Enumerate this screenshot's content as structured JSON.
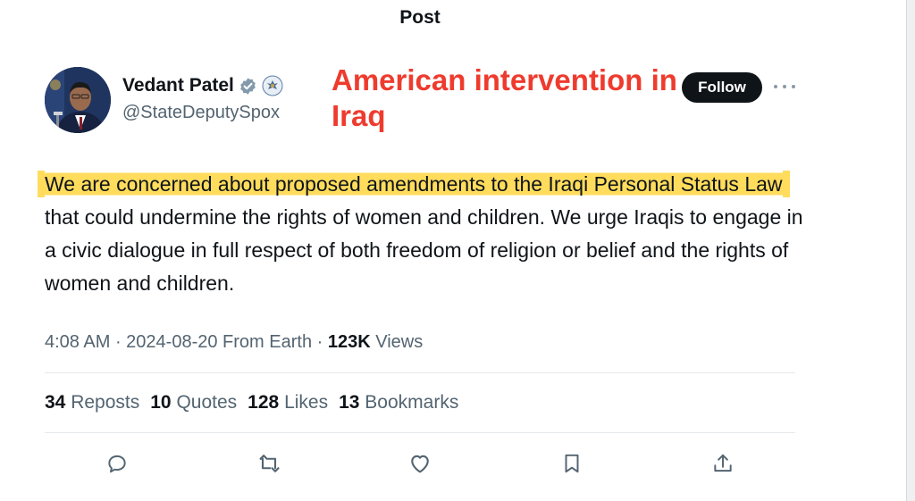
{
  "header": {
    "title": "Post"
  },
  "author": {
    "display_name": "Vedant Patel",
    "handle": "@StateDeputySpox",
    "follow_label": "Follow"
  },
  "annotation": {
    "text": "American intervention in Iraq"
  },
  "tweet": {
    "highlighted_text": "We are concerned about proposed amendments to the Iraqi Personal Status Law",
    "rest_text": " that could undermine the rights of women and children. We urge Iraqis to engage in a civic dialogue in full respect of both freedom of religion or belief and the rights of women and children."
  },
  "meta": {
    "time": "4:08 AM",
    "date": "2024-08-20",
    "source": "From Earth",
    "views_count": "123K",
    "views_label": "Views"
  },
  "stats": {
    "reposts_count": "34",
    "reposts_label": "Reposts",
    "quotes_count": "10",
    "quotes_label": "Quotes",
    "likes_count": "128",
    "likes_label": "Likes",
    "bookmarks_count": "13",
    "bookmarks_label": "Bookmarks"
  },
  "colors": {
    "annotation": "#ee3b2e",
    "highlight": "#ffd640",
    "text_primary": "#0f1419",
    "text_secondary": "#536471"
  },
  "icons": [
    "verified-badge-icon",
    "state-seal-icon",
    "more-icon",
    "reply-icon",
    "repost-icon",
    "like-icon",
    "bookmark-icon",
    "share-icon"
  ]
}
